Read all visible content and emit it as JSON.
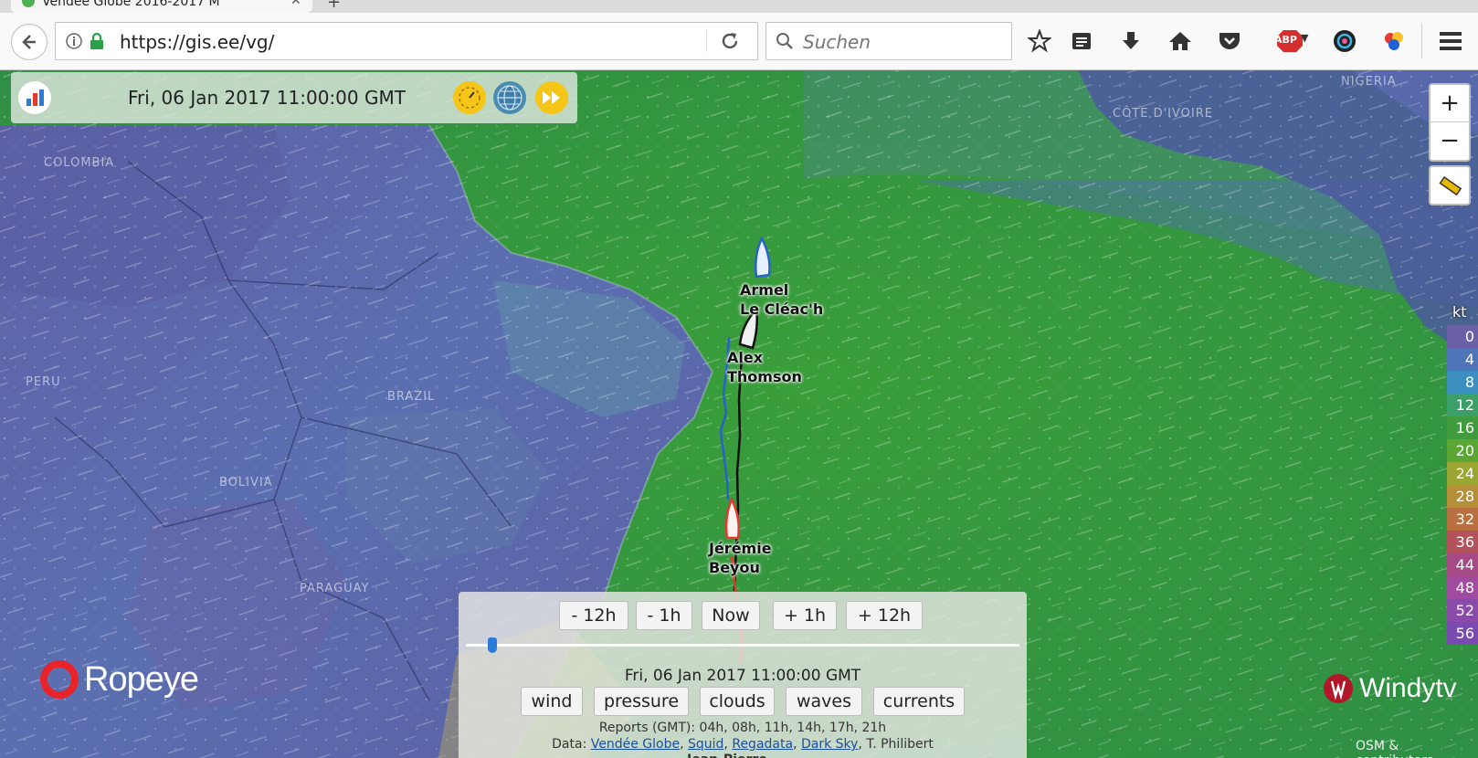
{
  "browser": {
    "tab_title": "Vendée Globe 2016-2017 M",
    "url": "https://gis.ee/vg/",
    "search_placeholder": "Suchen",
    "icons": [
      "back-arrow-icon",
      "info-icon",
      "lock-icon",
      "reload-icon",
      "search-icon",
      "star-icon",
      "reading-list-icon",
      "download-icon",
      "home-icon",
      "pocket-icon",
      "adblock-icon",
      "extension-icon",
      "color-extension-icon",
      "menu-icon"
    ],
    "adblock_label": "ABP"
  },
  "time_panel": {
    "datetime": "Fri, 06 Jan 2017 11:00:00 GMT"
  },
  "map": {
    "countries": [
      {
        "name": "COLOMBIA"
      },
      {
        "name": "PERU"
      },
      {
        "name": "BRAZIL"
      },
      {
        "name": "BOLIVIA"
      },
      {
        "name": "PARAGUAY"
      },
      {
        "name": "NIGERIA"
      },
      {
        "name": "CÔTE D'IVOIRE"
      }
    ],
    "zoom_in": "+",
    "zoom_out": "−"
  },
  "boats": [
    {
      "first": "Armel",
      "last": "Le Cléac'h",
      "color": "#2563c8"
    },
    {
      "first": "Alex",
      "last": "Thomson",
      "color": "#111111"
    },
    {
      "first": "Jérémie",
      "last": "Beyou",
      "color": "#e23b2e"
    }
  ],
  "legend": {
    "unit": "kt",
    "values": [
      "0",
      "4",
      "8",
      "12",
      "16",
      "20",
      "24",
      "28",
      "32",
      "36",
      "44",
      "48",
      "52",
      "56"
    ],
    "colors": [
      "#6b5fa5",
      "#4f74b8",
      "#3b8fbf",
      "#3aa067",
      "#3f9b3c",
      "#5aa833",
      "#9aa532",
      "#b58f37",
      "#b87040",
      "#b3525a",
      "#a64a86",
      "#a04aa0",
      "#8a4aa8",
      "#7a4ab0"
    ]
  },
  "bottom_panel": {
    "step_buttons": [
      "- 12h",
      "- 1h",
      "Now",
      "+ 1h",
      "+ 12h"
    ],
    "slider_position": 0.04,
    "datetime": "Fri, 06 Jan 2017 11:00:00 GMT",
    "layers": [
      "wind",
      "pressure",
      "clouds",
      "waves",
      "currents"
    ],
    "reports": "Reports (GMT): 04h, 08h, 11h, 14h, 17h, 21h",
    "data_prefix": "Data:",
    "sources": [
      "Vendée Globe",
      "Squid",
      "Regadata",
      "Dark Sky"
    ],
    "sources_suffix": "T. Philibert",
    "hidden_label": "Jean-Pierre"
  },
  "branding": {
    "ropeye": "Ropeye",
    "windy": "Windytv",
    "attribution": "OSM & contributors"
  }
}
